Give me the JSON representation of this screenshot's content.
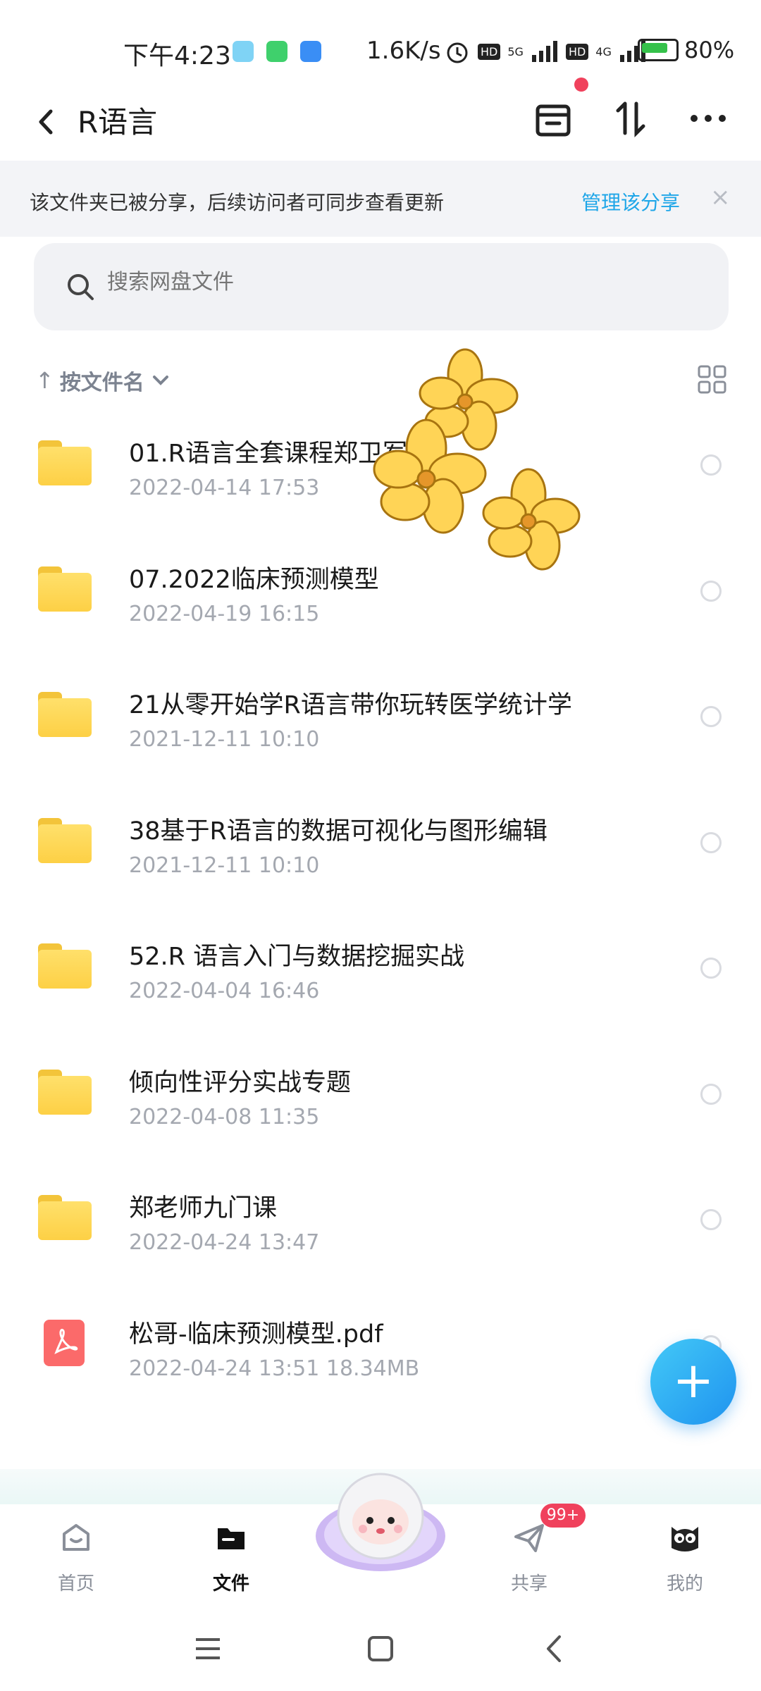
{
  "status_bar": {
    "time": "下午4:23",
    "speed": "1.6K/s",
    "battery": "80%",
    "network_5g": "5G",
    "network_4g": "4G",
    "hd1": "HD",
    "hd2": "HD"
  },
  "header": {
    "title": "R语言"
  },
  "share_banner": {
    "text": "该文件夹已被分享，后续访问者可同步查看更新",
    "manage": "管理该分享",
    "close": "×"
  },
  "search": {
    "placeholder": "搜索网盘文件"
  },
  "sort": {
    "label": "按文件名"
  },
  "files": [
    {
      "name": "01.R语言全套课程郑卫军",
      "meta": "2022-04-14  17:53",
      "type": "folder"
    },
    {
      "name": "07.2022临床预测模型",
      "meta": "2022-04-19  16:15",
      "type": "folder"
    },
    {
      "name": "21从零开始学R语言带你玩转医学统计学",
      "meta": "2021-12-11  10:10",
      "type": "folder"
    },
    {
      "name": "38基于R语言的数据可视化与图形编辑",
      "meta": "2021-12-11  10:10",
      "type": "folder"
    },
    {
      "name": "52.R 语言入门与数据挖掘实战",
      "meta": "2022-04-04  16:46",
      "type": "folder"
    },
    {
      "name": "倾向性评分实战专题",
      "meta": "2022-04-08  11:35",
      "type": "folder"
    },
    {
      "name": "郑老师九门课",
      "meta": "2022-04-24  13:47",
      "type": "folder"
    },
    {
      "name": "松哥-临床预测模型.pdf",
      "meta": "2022-04-24  13:51  18.34MB",
      "type": "pdf"
    }
  ],
  "bottom_nav": {
    "home": "首页",
    "files": "文件",
    "share": "共享",
    "mine": "我的",
    "share_badge": "99+"
  },
  "colors": {
    "accent": "#1fa6e8",
    "folder": "#fdd045",
    "pdf": "#fb6a6a",
    "badge": "#f0415c"
  }
}
